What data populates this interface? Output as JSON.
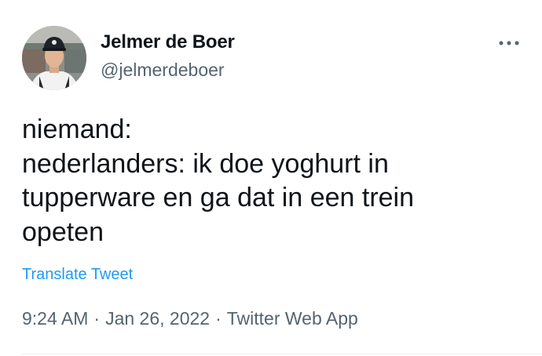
{
  "author": {
    "display_name": "Jelmer de Boer",
    "handle": "@jelmerdeboer"
  },
  "tweet": {
    "lines": [
      "niemand:",
      "nederlanders: ik doe yoghurt in",
      "tupperware en ga dat in een trein",
      "opeten"
    ],
    "translate_label": "Translate Tweet",
    "time": "9:24 AM",
    "separator": "·",
    "date": "Jan 26, 2022",
    "source": "Twitter Web App"
  },
  "icons": {
    "more": "more-horizontal-icon",
    "avatar": "profile-photo"
  },
  "colors": {
    "text": "#0f1419",
    "secondary": "#536471",
    "link": "#1d9bf0",
    "divider": "#eff3f4"
  }
}
